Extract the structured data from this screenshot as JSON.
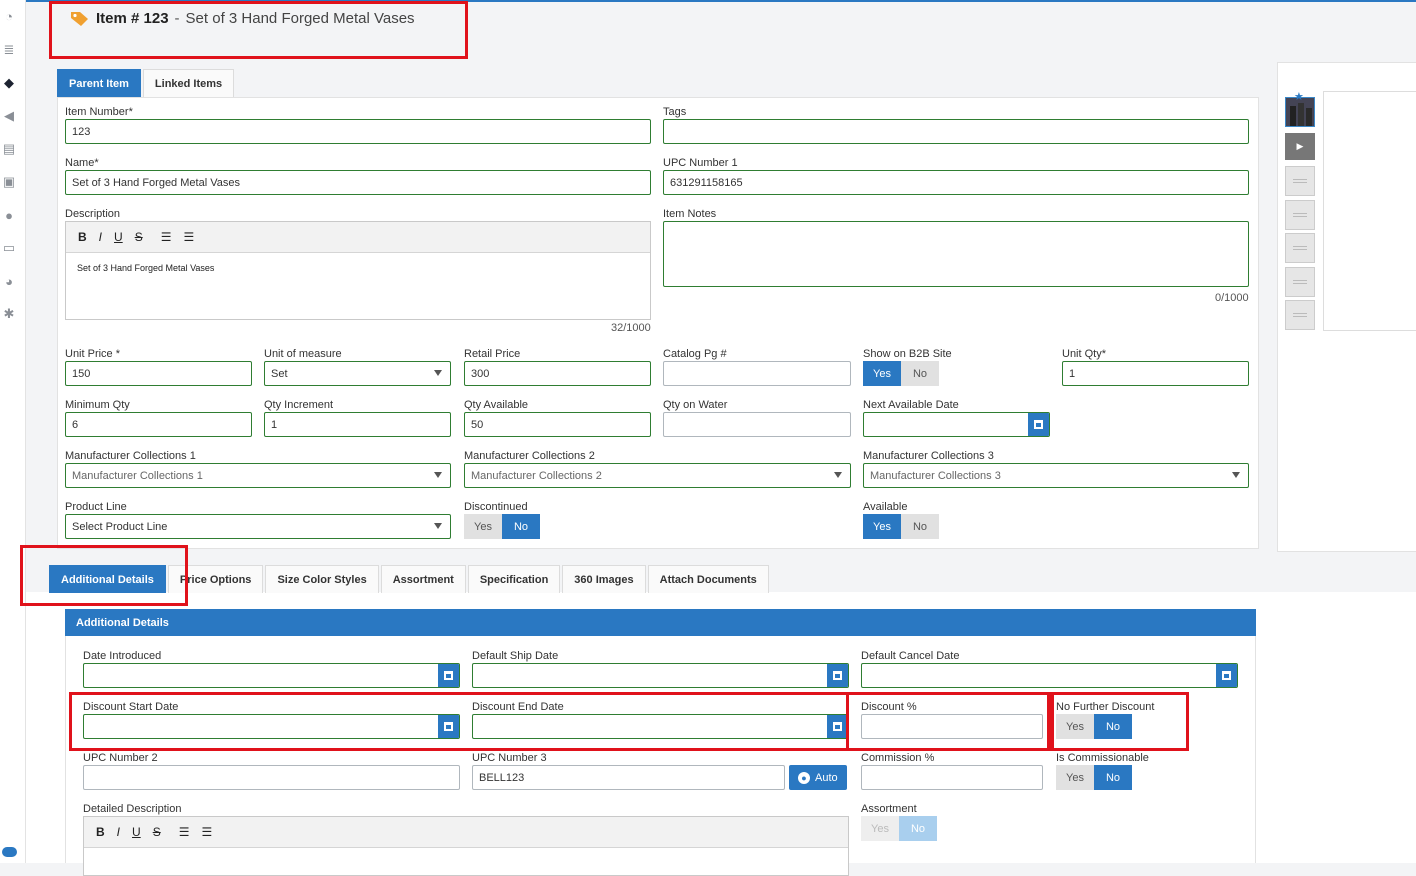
{
  "header": {
    "item_label": "Item # 123",
    "separator": "-",
    "item_name": "Set of 3 Hand Forged Metal Vases",
    "tag_icon": "tag-icon"
  },
  "parent_tabs": [
    {
      "label": "Parent Item",
      "active": true
    },
    {
      "label": "Linked Items",
      "active": false
    }
  ],
  "form": {
    "item_number": {
      "label": "Item Number*",
      "value": "123"
    },
    "tags": {
      "label": "Tags",
      "value": ""
    },
    "name": {
      "label": "Name*",
      "value": "Set of 3 Hand Forged Metal Vases"
    },
    "upc1": {
      "label": "UPC Number 1",
      "value": "631291158165"
    },
    "description": {
      "label": "Description",
      "value": "Set of 3 Hand Forged Metal Vases",
      "counter": "32/1000",
      "toolbar": [
        "B",
        "I",
        "U",
        "S",
        "ol",
        "ul"
      ]
    },
    "item_notes": {
      "label": "Item Notes",
      "value": "",
      "counter": "0/1000"
    },
    "unit_price": {
      "label": "Unit Price *",
      "value": "150"
    },
    "unit_of_measure": {
      "label": "Unit of measure",
      "value": "Set"
    },
    "retail_price": {
      "label": "Retail Price",
      "value": "300"
    },
    "catalog_pg": {
      "label": "Catalog Pg #",
      "value": ""
    },
    "show_b2b": {
      "label": "Show on B2B Site",
      "yes": "Yes",
      "no": "No",
      "selected": "Yes"
    },
    "unit_qty": {
      "label": "Unit Qty*",
      "value": "1"
    },
    "min_qty": {
      "label": "Minimum Qty",
      "value": "6"
    },
    "qty_increment": {
      "label": "Qty Increment",
      "value": "1"
    },
    "qty_available": {
      "label": "Qty Available",
      "value": "50"
    },
    "qty_on_water": {
      "label": "Qty on Water",
      "value": ""
    },
    "next_available_date": {
      "label": "Next Available Date",
      "value": ""
    },
    "mfr_col1": {
      "label": "Manufacturer Collections 1",
      "placeholder": "Manufacturer Collections 1"
    },
    "mfr_col2": {
      "label": "Manufacturer Collections 2",
      "placeholder": "Manufacturer Collections 2"
    },
    "mfr_col3": {
      "label": "Manufacturer Collections 3",
      "placeholder": "Manufacturer Collections 3"
    },
    "product_line": {
      "label": "Product Line",
      "placeholder": "Select Product Line"
    },
    "discontinued": {
      "label": "Discontinued",
      "yes": "Yes",
      "no": "No",
      "selected": "No"
    },
    "available": {
      "label": "Available",
      "yes": "Yes",
      "no": "No",
      "selected": "Yes"
    }
  },
  "detail_tabs": [
    {
      "label": "Additional Details",
      "active": true
    },
    {
      "label": "Price Options"
    },
    {
      "label": "Size Color Styles"
    },
    {
      "label": "Assortment"
    },
    {
      "label": "Specification"
    },
    {
      "label": "360 Images"
    },
    {
      "label": "Attach Documents"
    }
  ],
  "additional": {
    "section_title": "Additional Details",
    "date_introduced": {
      "label": "Date Introduced",
      "value": ""
    },
    "default_ship_date": {
      "label": "Default Ship Date",
      "value": ""
    },
    "default_cancel_date": {
      "label": "Default Cancel Date",
      "value": ""
    },
    "discount_start": {
      "label": "Discount Start Date",
      "value": ""
    },
    "discount_end": {
      "label": "Discount End Date",
      "value": ""
    },
    "discount_pct": {
      "label": "Discount %",
      "value": ""
    },
    "no_further_discount": {
      "label": "No Further Discount",
      "yes": "Yes",
      "no": "No",
      "selected": "No"
    },
    "upc2": {
      "label": "UPC Number 2",
      "value": ""
    },
    "upc3": {
      "label": "UPC Number 3",
      "value": "BELL123",
      "auto_label": "Auto"
    },
    "commission_pct": {
      "label": "Commission %",
      "value": ""
    },
    "is_commissionable": {
      "label": "Is Commissionable",
      "yes": "Yes",
      "no": "No",
      "selected": "No"
    },
    "detailed_description": {
      "label": "Detailed Description",
      "toolbar": [
        "B",
        "I",
        "U",
        "S",
        "ol",
        "ul"
      ]
    },
    "assortment": {
      "label": "Assortment",
      "yes": "Yes",
      "no": "No",
      "selected": "No",
      "disabled": true
    }
  },
  "colors": {
    "primary": "#2a78c2",
    "valid_border": "#2f7d32",
    "highlight": "#e0121b",
    "tag": "#f0a030"
  }
}
